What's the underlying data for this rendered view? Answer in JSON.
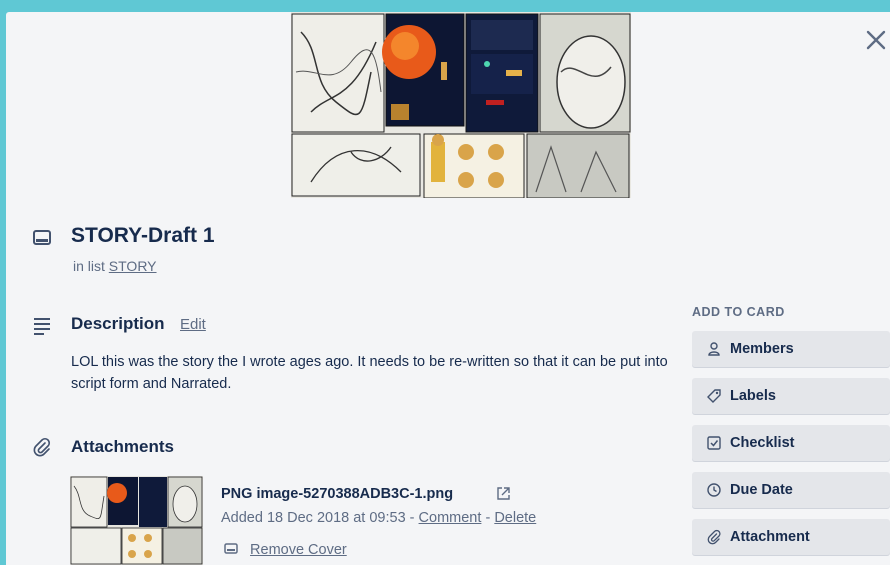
{
  "card": {
    "title": "STORY-Draft 1",
    "in_list_prefix": "in list",
    "list_name": "STORY"
  },
  "description": {
    "heading": "Description",
    "edit_label": "Edit",
    "text": "LOL this was the story the I wrote ages ago. It needs to be re-written so that it can be put into script form and Narrated."
  },
  "attachments": {
    "heading": "Attachments",
    "items": [
      {
        "name": "PNG image-5270388ADB3C-1.png",
        "added_prefix": "Added",
        "added": "18 Dec 2018 at 09:53",
        "sep": "-",
        "comment_label": "Comment",
        "delete_label": "Delete",
        "remove_cover_label": "Remove Cover"
      }
    ]
  },
  "sidebar": {
    "title": "ADD TO CARD",
    "buttons": [
      {
        "label": "Members",
        "icon": "person-icon"
      },
      {
        "label": "Labels",
        "icon": "tag-icon"
      },
      {
        "label": "Checklist",
        "icon": "checkbox-icon"
      },
      {
        "label": "Due Date",
        "icon": "clock-icon"
      },
      {
        "label": "Attachment",
        "icon": "paperclip-icon"
      }
    ]
  },
  "colors": {
    "backdrop": "#5fc8d4",
    "modal_bg": "#f4f5f7",
    "text": "#172b4d",
    "muted": "#5e6c84",
    "button_bg": "#e4e6ea"
  }
}
